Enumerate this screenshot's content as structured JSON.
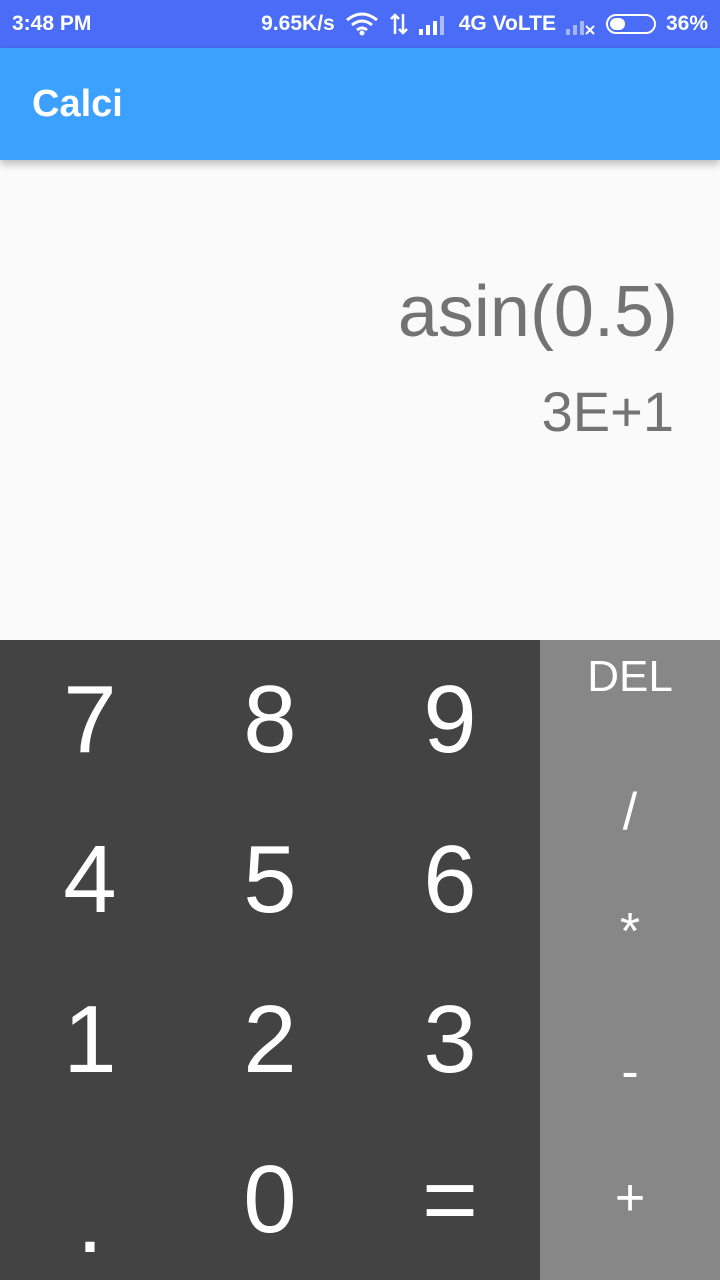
{
  "status_bar": {
    "time": "3:48 PM",
    "speed": "9.65K/s",
    "network": "4G VoLTE",
    "battery": "36%",
    "battery_level": 0.36
  },
  "app": {
    "title": "Calci"
  },
  "display": {
    "expression": "asin(0.5)",
    "result": "3E+1"
  },
  "keypad": {
    "digits": [
      "7",
      "8",
      "9",
      "4",
      "5",
      "6",
      "1",
      "2",
      "3",
      ".",
      "0",
      "="
    ],
    "ops": [
      "DEL",
      "/",
      "*",
      "-",
      "+"
    ]
  },
  "colors": {
    "status_bar": "#4a6cf7",
    "app_bar": "#3ca0ff",
    "numpad": "#434343",
    "opspad": "#878787",
    "display_text": "#737373"
  }
}
